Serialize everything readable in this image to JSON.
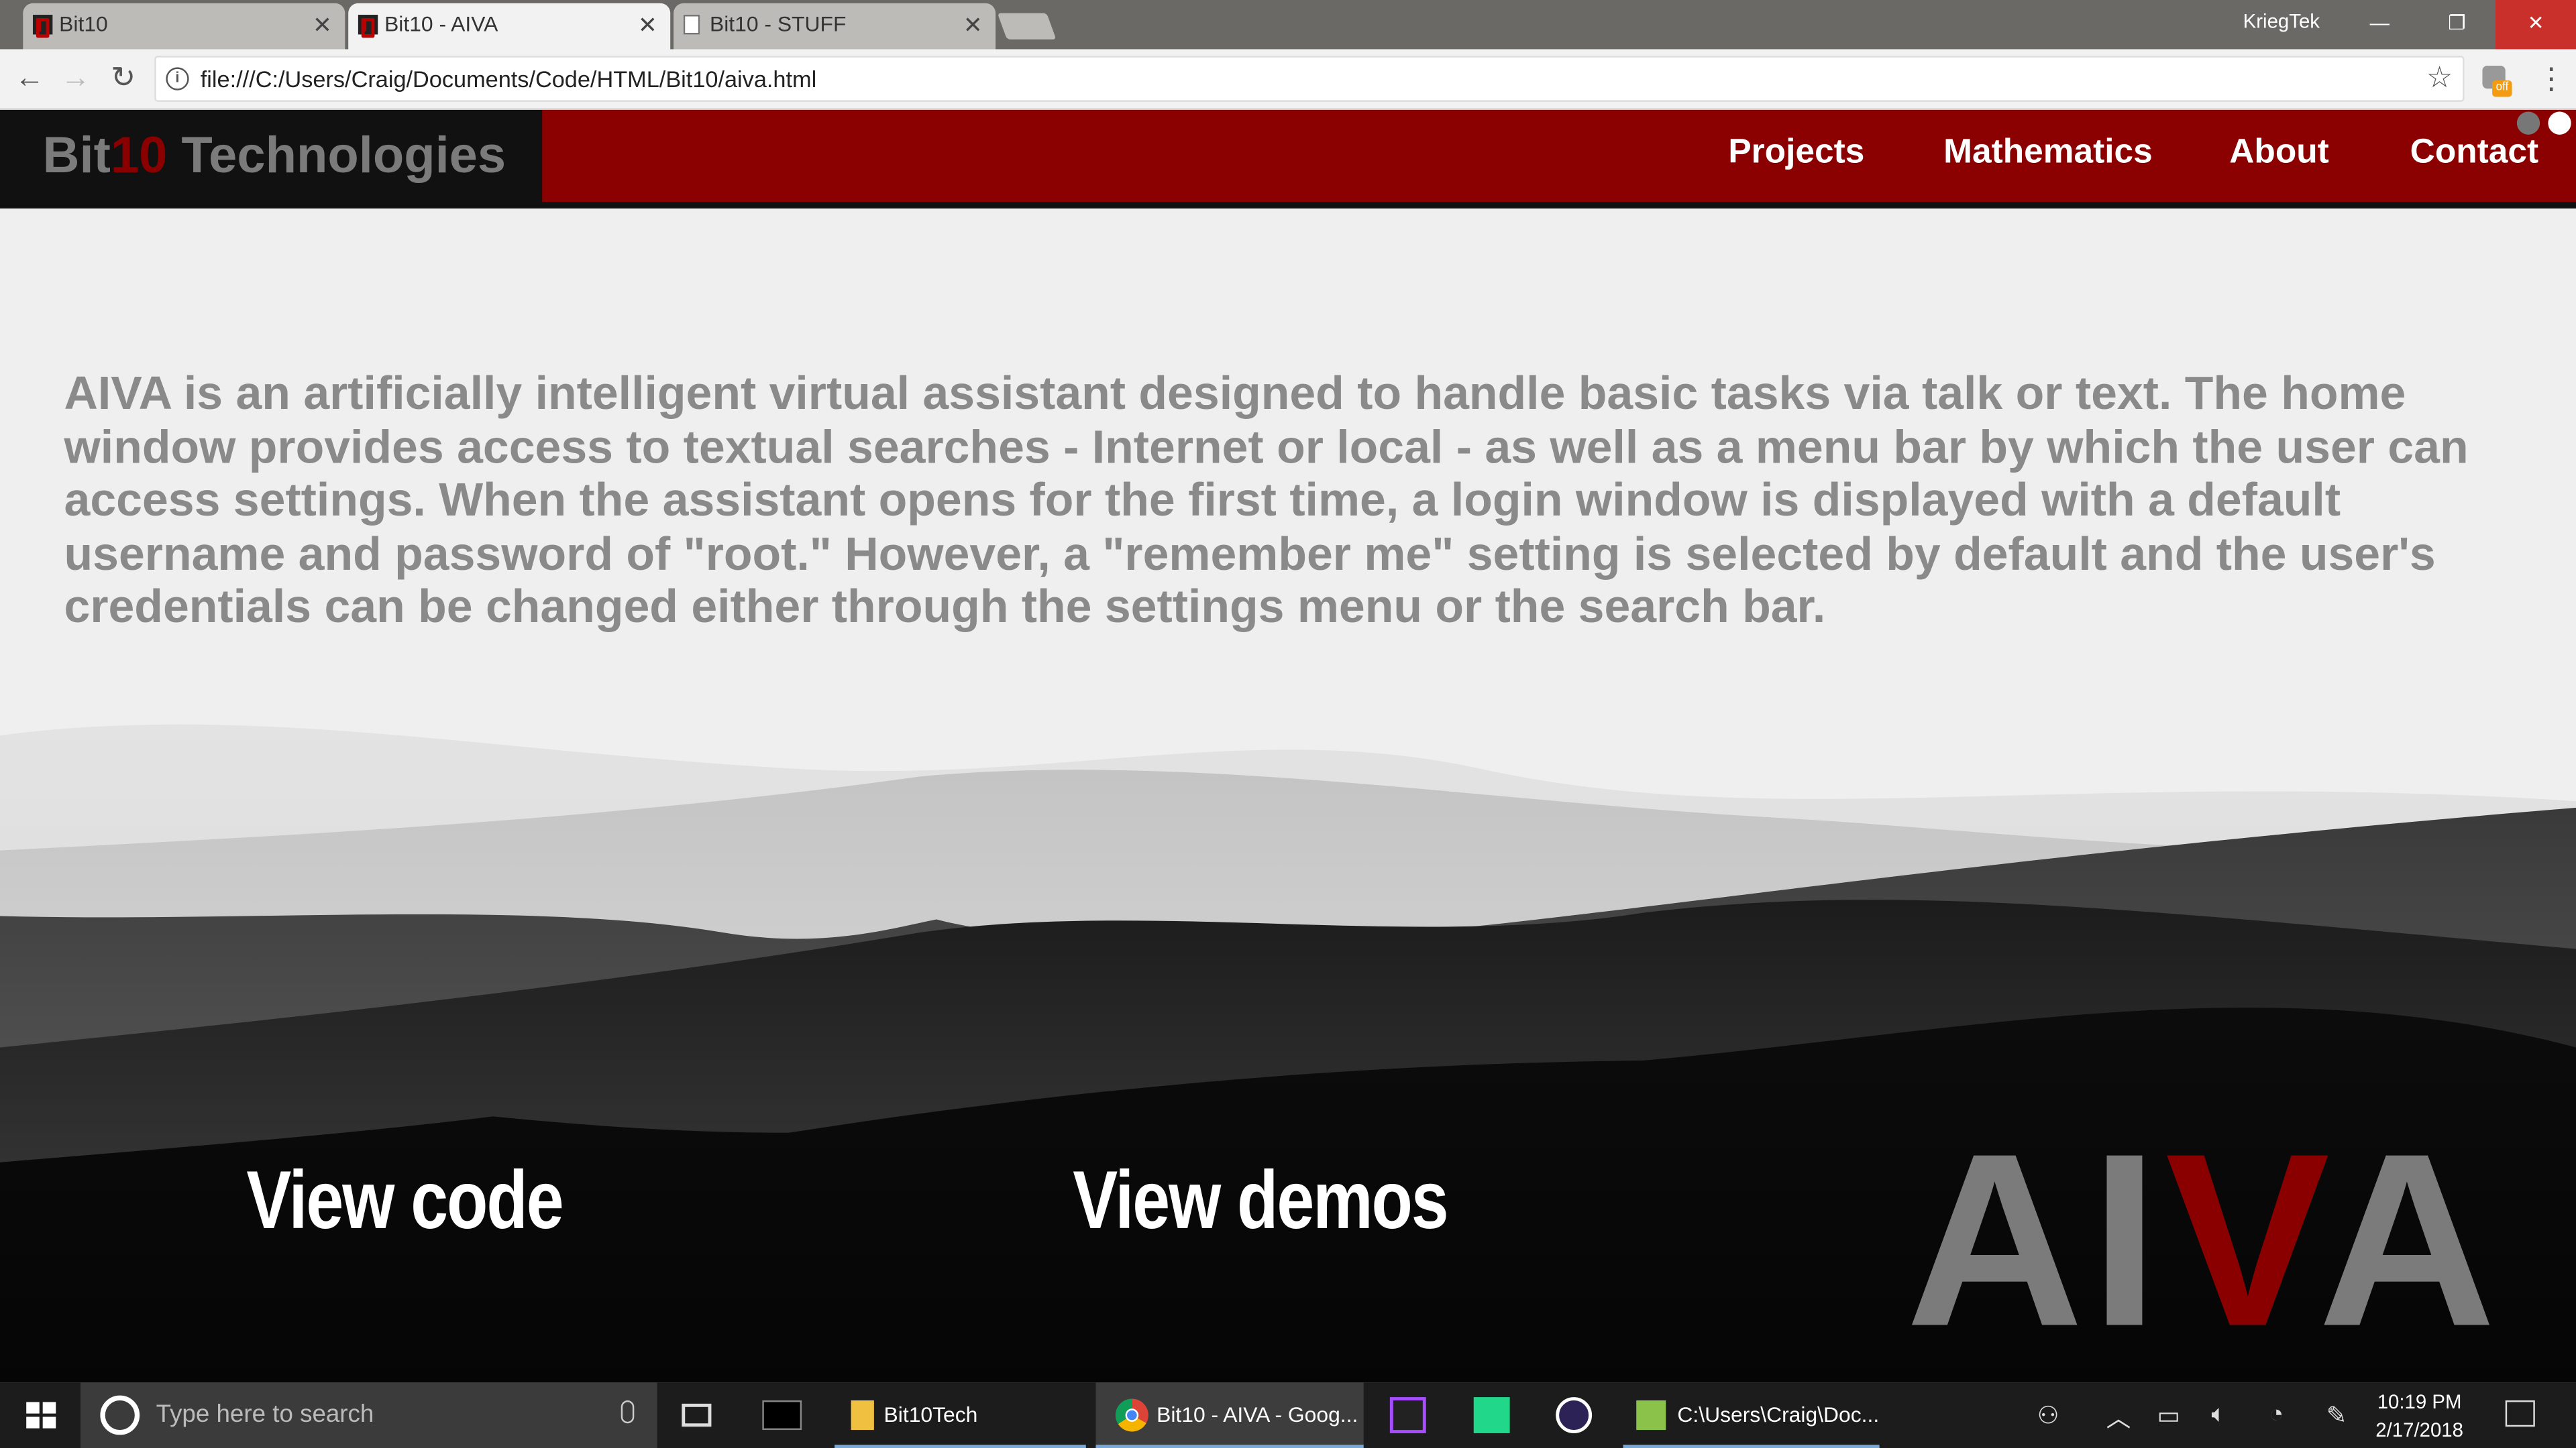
{
  "browser": {
    "tabs": [
      {
        "title": "Bit10"
      },
      {
        "title": "Bit10 - AIVA"
      },
      {
        "title": "Bit10 - STUFF"
      }
    ],
    "profile_name": "KriegTek",
    "url": "file:///C:/Users/Craig/Documents/Code/HTML/Bit10/aiva.html",
    "extension_badge": "off"
  },
  "site": {
    "brand_prefix": "Bit",
    "brand_accent": "10",
    "brand_suffix": " Technologies",
    "nav": [
      "Projects",
      "Mathematics",
      "About",
      "Contact"
    ],
    "description": "AIVA is an artificially intelligent virtual assistant designed to handle basic tasks via talk or text. The home window provides access to textual searches - Internet or local - as well as a menu bar by which the user can access settings. When the assistant opens for the first time, a login window is displayed with a default username and password of \"root.\" However, a \"remember me\" setting is selected by default and the user's credentials can be changed either through the settings menu or the search bar.",
    "view_code": "View code",
    "view_demos": "View demos",
    "logo_a": "AI",
    "logo_v": "V",
    "logo_b": "A",
    "colors": {
      "accent": "#8b0000",
      "text_gray": "#8a8a8a"
    }
  },
  "taskbar": {
    "search_placeholder": "Type here to search",
    "items": [
      "Bit10Tech",
      "Bit10 - AIVA - Goog...",
      "C:\\Users\\Craig\\Doc..."
    ],
    "time": "10:19 PM",
    "date": "2/17/2018"
  }
}
